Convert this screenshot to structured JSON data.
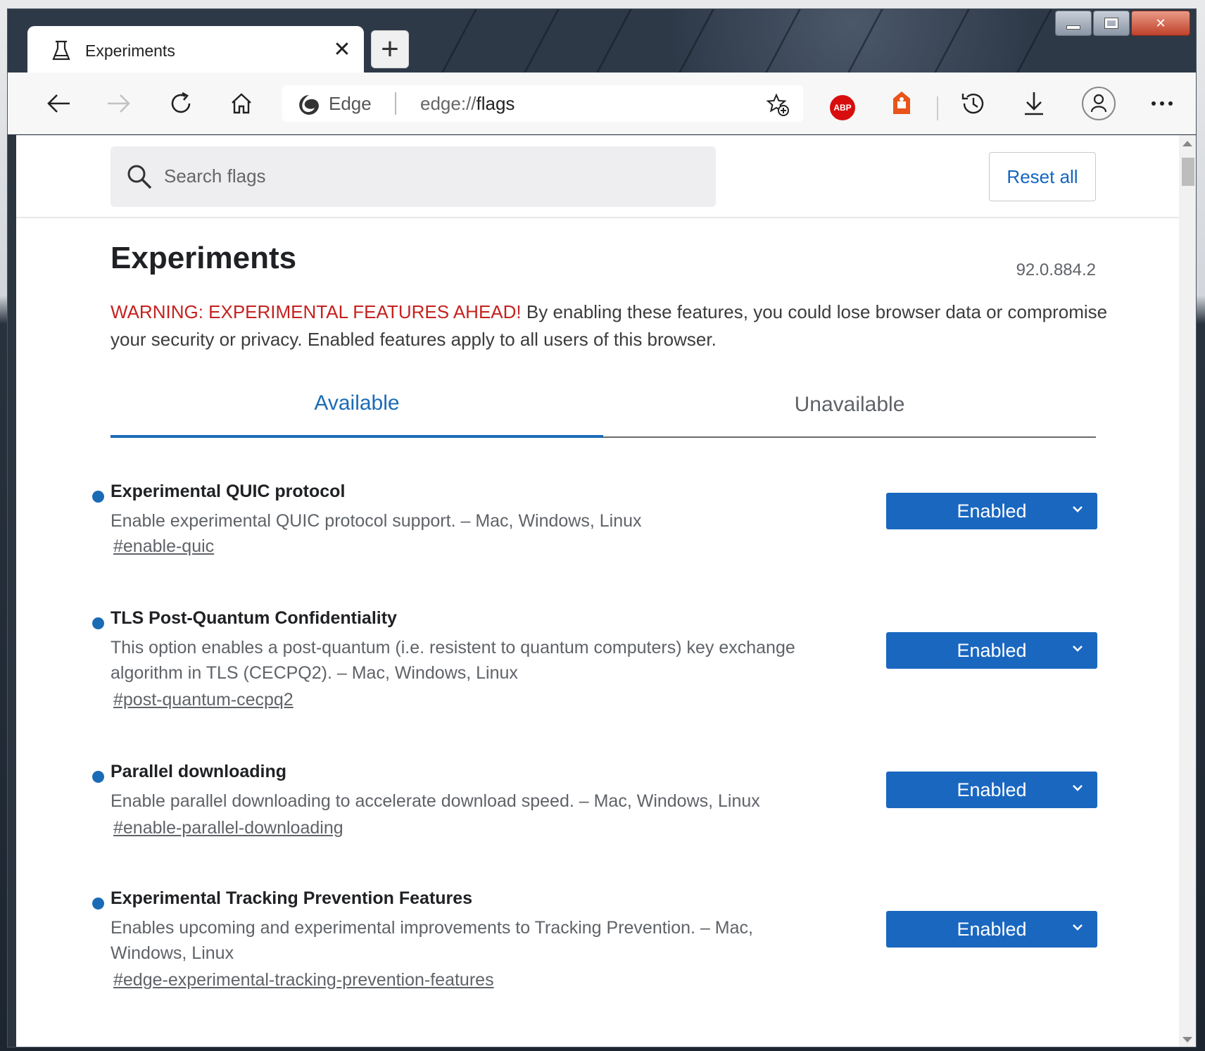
{
  "window": {
    "tab_title": "Experiments",
    "tab_close": "✕",
    "new_tab": "+"
  },
  "address_bar": {
    "site_name": "Edge",
    "url_prefix": "edge://",
    "url_page": "flags"
  },
  "toolbar_icons": [
    "back-icon",
    "forward-icon",
    "refresh-icon",
    "home-icon",
    "add-favorite-icon",
    "adblock-plus-icon",
    "extension-icon",
    "history-icon",
    "download-icon",
    "profile-icon",
    "more-icon"
  ],
  "extensions": {
    "abp_label": "ABP"
  },
  "search": {
    "placeholder": "Search flags"
  },
  "reset_all_label": "Reset all",
  "page": {
    "heading": "Experiments",
    "version": "92.0.884.2",
    "warning_label": "WARNING: EXPERIMENTAL FEATURES AHEAD!",
    "warning_text": " By enabling these features, you could lose browser data or compromise your security or privacy. Enabled features apply to all users of this browser."
  },
  "tabs": {
    "available": "Available",
    "unavailable": "Unavailable"
  },
  "flags": [
    {
      "title": "Experimental QUIC protocol",
      "description": "Enable experimental QUIC protocol support. – Mac, Windows, Linux",
      "link": "#enable-quic",
      "value": "Enabled"
    },
    {
      "title": "TLS Post-Quantum Confidentiality",
      "description": "This option enables a post-quantum (i.e. resistent to quantum computers) key exchange algorithm in TLS (CECPQ2). – Mac, Windows, Linux",
      "link": "#post-quantum-cecpq2",
      "value": "Enabled"
    },
    {
      "title": "Parallel downloading",
      "description": "Enable parallel downloading to accelerate download speed. – Mac, Windows, Linux",
      "link": "#enable-parallel-downloading",
      "value": "Enabled"
    },
    {
      "title": "Experimental Tracking Prevention Features",
      "description": "Enables upcoming and experimental improvements to Tracking Prevention. – Mac, Windows, Linux",
      "link": "#edge-experimental-tracking-prevention-features",
      "value": "Enabled"
    }
  ],
  "colors": {
    "accent": "#1a6bb5",
    "select_bg": "#1a67c0",
    "warning": "#c5221f"
  }
}
